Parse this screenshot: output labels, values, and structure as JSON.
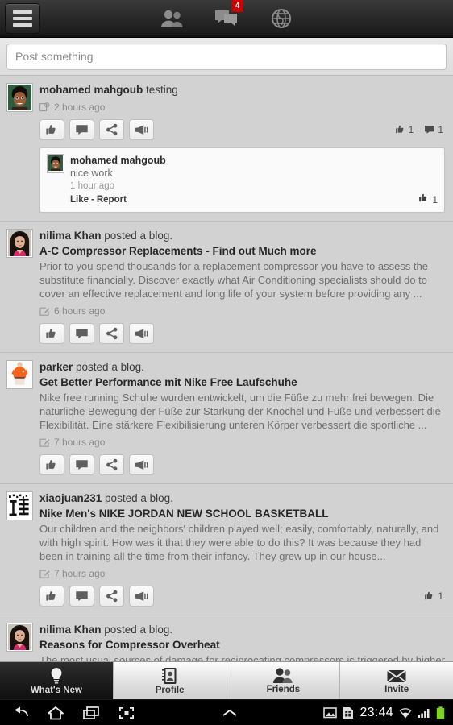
{
  "appbar": {
    "menu_icon": "hamburger-icon",
    "icons": [
      {
        "name": "friends-icon",
        "badge": null
      },
      {
        "name": "messages-icon",
        "badge": "4"
      },
      {
        "name": "globe-icon",
        "badge": null
      }
    ],
    "badge_color": "#cc0000"
  },
  "composer": {
    "placeholder": "Post something",
    "value": ""
  },
  "feed": {
    "posts": [
      {
        "author": "mohamed mahgoub",
        "action": " testing",
        "title": "",
        "excerpt": "",
        "time": "2 hours ago",
        "time_icon": "status-post-icon",
        "avatar": "avatar-mohamed",
        "likes": "1",
        "comments": "1",
        "comment": {
          "author": "mohamed mahgoub",
          "text": "nice work",
          "time": "1 hour ago",
          "like_label": "Like",
          "separator": "-",
          "report_label": "Report",
          "likes": "1"
        }
      },
      {
        "author": "nilima Khan",
        "action": " posted a blog.",
        "title": "A-C Compressor Replacements - Find out Much more",
        "excerpt": "Prior to you spend thousands for a replacement compressor you have to assess the substitute financially. Discover exactly what Air Conditioning specialists should do to cover an effective replacement and long life of your system before providing any ...",
        "time": "6 hours ago",
        "time_icon": "blog-post-icon",
        "avatar": "avatar-nilima",
        "likes": "",
        "comments": "",
        "comment": null
      },
      {
        "author": "parker",
        "action": " posted a blog.",
        "title": "Get Better Performance mit Nike Free Laufschuhe",
        "excerpt": "Nike free running Schuhe wurden entwickelt, um die Füße zu mehr frei bewegen. Die natürliche Bewegung der Füße zur Stärkung der Knöchel und Füße und verbessert die Flexibilität. Eine stärkere Flexibilisierung unteren Körper verbessert die sportliche ...",
        "time": "7 hours ago",
        "time_icon": "blog-post-icon",
        "avatar": "avatar-parker",
        "likes": "",
        "comments": "",
        "comment": null
      },
      {
        "author": "xiaojuan231",
        "action": " posted a blog.",
        "title": "Nike Men's NIKE JORDAN NEW SCHOOL BASKETBALL",
        "excerpt": "Our children and the neighbors' children played well; easily, comfortably, naturally, and with high spirit. How was it that they were able to do this? It was because they had been in training all the time from their infancy. They grew up in our house...",
        "time": "7 hours ago",
        "time_icon": "blog-post-icon",
        "avatar": "avatar-xiaojuan",
        "likes": "1",
        "comments": "",
        "comment": null
      },
      {
        "author": "nilima Khan",
        "action": " posted a blog.",
        "title": "Reasons for Compressor Overheat",
        "excerpt": "The most usual sources of damage for reciprocating compressors is triggered by higher",
        "time": "",
        "time_icon": "blog-post-icon",
        "avatar": "avatar-nilima",
        "likes": "",
        "comments": "",
        "comment": null
      }
    ],
    "action_buttons": [
      {
        "name": "like-button",
        "icon": "thumbs-up-icon"
      },
      {
        "name": "comment-button",
        "icon": "speech-bubble-icon"
      },
      {
        "name": "share-button",
        "icon": "share-nodes-icon"
      },
      {
        "name": "promote-button",
        "icon": "megaphone-icon"
      }
    ]
  },
  "tabs": [
    {
      "label": "What's New",
      "icon": "lightbulb-icon",
      "active": true
    },
    {
      "label": "Profile",
      "icon": "contact-card-icon",
      "active": false
    },
    {
      "label": "Friends",
      "icon": "friends-icon",
      "active": false
    },
    {
      "label": "Invite",
      "icon": "envelope-icon",
      "active": false
    }
  ],
  "system_bar": {
    "nav": [
      "back-icon",
      "home-icon",
      "recents-icon",
      "screenshot-icon",
      "expand-caret-icon"
    ],
    "status": [
      "image-icon",
      "sim-card-icon"
    ],
    "clock": "23:44",
    "indicators": [
      "wifi-icon",
      "signal-icon",
      "battery-icon"
    ],
    "battery_color": "#7ed321"
  }
}
